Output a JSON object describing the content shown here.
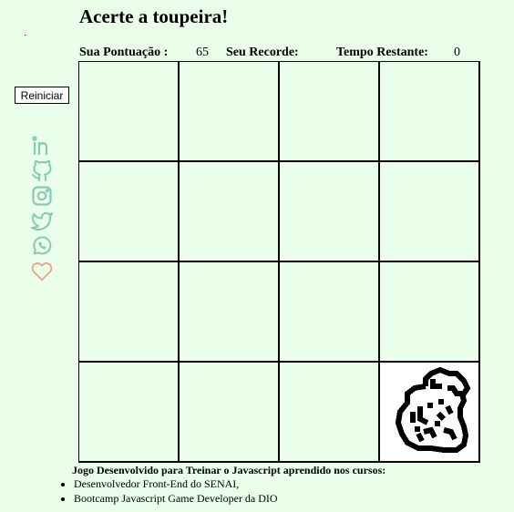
{
  "title": "Acerte a toupeira!",
  "stats": {
    "score_label": "Sua Pontuação :",
    "score_value": "65",
    "record_label": "Seu Recorde:",
    "record_value": "",
    "time_label": "Tempo Restante:",
    "time_value": "0"
  },
  "restart_label": "Reiniciar",
  "socials": [
    {
      "icon": "linkedin-icon",
      "color": "#87c9b4"
    },
    {
      "icon": "github-icon",
      "color": "#87c9b4"
    },
    {
      "icon": "instagram-icon",
      "color": "#87c9b4"
    },
    {
      "icon": "twitter-icon",
      "color": "#87c9b4"
    },
    {
      "icon": "whatsapp-icon",
      "color": "#87c9b4"
    },
    {
      "icon": "heart-icon",
      "color": "#f0967a"
    }
  ],
  "grid": {
    "rows": 4,
    "cols": 4,
    "mole_cell": 15
  },
  "footer": {
    "heading": "Jogo Desenvolvido para Treinar o Javascript aprendido nos cursos:",
    "courses": [
      "Desenvolvedor Front-End do SENAI,",
      "Bootcamp Javascript Game Developer da DIO"
    ]
  },
  "colors": {
    "background": "#e9ffe9",
    "grid_line": "#000000",
    "mole_cell_bg": "#ffffff",
    "social_teal": "#87c9b4",
    "heart": "#f0967a"
  }
}
